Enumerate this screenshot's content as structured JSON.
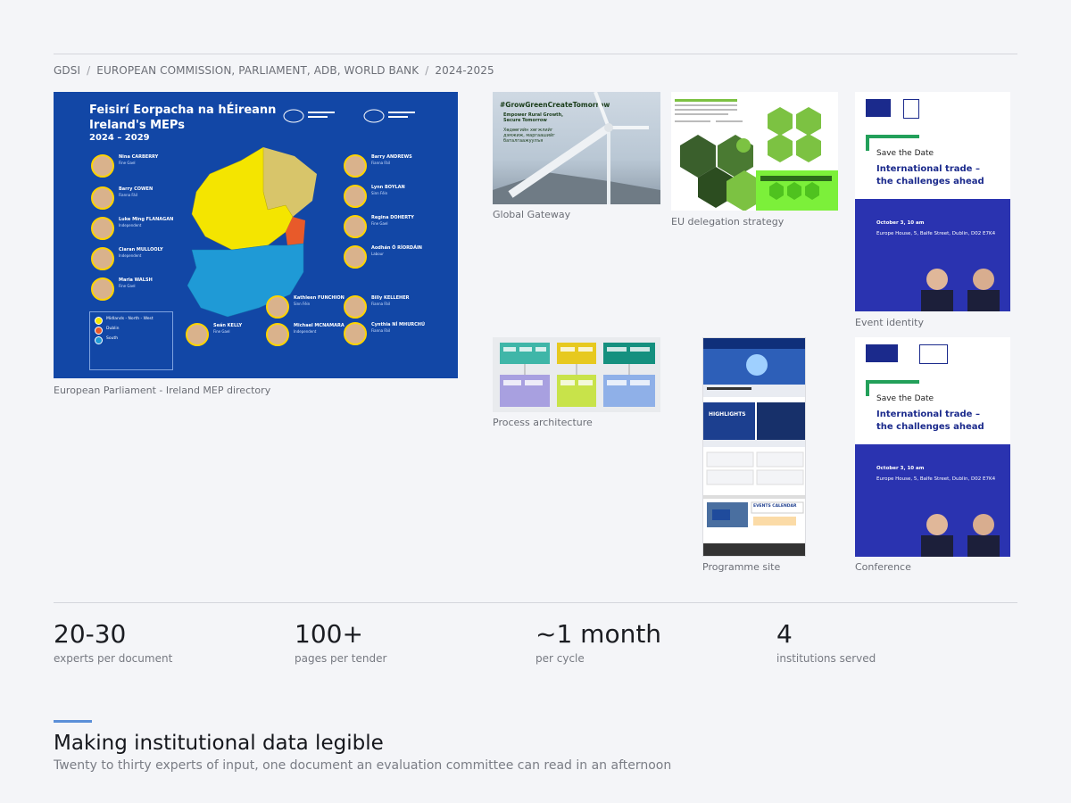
{
  "breadcrumb": [
    "GDSI",
    "EUROPEAN COMMISSION, PARLIAMENT, ADB, WORLD BANK",
    "2024-2025"
  ],
  "gallery": {
    "mep": {
      "caption": "European Parliament  -  Ireland MEP directory",
      "title_line1": "Feisirí Eorpacha na hÉireann",
      "title_line2": "Ireland's MEPs",
      "years": "2024 – 2029",
      "left_members": [
        {
          "name": "Nina CARBERRY",
          "party": "Fine Gael"
        },
        {
          "name": "Barry COWEN",
          "party": "Fianna Fáil"
        },
        {
          "name": "Luke Ming FLANAGAN",
          "party": "Independent"
        },
        {
          "name": "Ciaran MULLOOLY",
          "party": "Independent"
        },
        {
          "name": "Maria WALSH",
          "party": "Fine Gael"
        }
      ],
      "right_members": [
        {
          "name": "Barry ANDREWS",
          "party": "Fianna Fáil"
        },
        {
          "name": "Lynn BOYLAN",
          "party": "Sinn Féin"
        },
        {
          "name": "Regina DOHERTY",
          "party": "Fine Gael"
        },
        {
          "name": "Aodhán Ó RÍORDÁIN",
          "party": "Labour"
        },
        {
          "name": "Billy KELLEHER",
          "party": "Fianna Fáil"
        },
        {
          "name": "Cynthia NÍ MHURCHÚ",
          "party": "Fianna Fáil"
        }
      ],
      "centre_members": [
        {
          "name": "Kathleen FUNCHION",
          "party": "Sinn Féin"
        },
        {
          "name": "Michael MCNAMARA",
          "party": "Independent"
        },
        {
          "name": "Seán KELLY",
          "party": "Fine Gael"
        }
      ],
      "legend": [
        {
          "label": "Midlands - North - West",
          "color": "#f4e500"
        },
        {
          "label": "Dublin",
          "color": "#e85a2a"
        },
        {
          "label": "South",
          "color": "#1f9ad6"
        }
      ]
    },
    "global_gateway": {
      "caption": "Global Gateway",
      "hashtag": "#GrowGreenCreateTomorrow",
      "slogan": "Empower Rural Growth, Secure Tomorrow",
      "cyrillic": "Хөдөөгийн хөгжлийг дэмжиж, маргаашийг баталгаажуулъя"
    },
    "eu_delegation": {
      "caption": "EU delegation strategy"
    },
    "event_identity": {
      "caption": "Event identity",
      "save": "Save the Date",
      "title_line1": "International trade –",
      "title_line2": "the challenges ahead",
      "date": "October 3, 10 am",
      "place": "Europe House, 5, Balfe Street, Dublin, D02 E7K4"
    },
    "process": {
      "caption": "Process architecture"
    },
    "programme": {
      "caption": "Programme site",
      "highlights": "HIGHLIGHTS",
      "events": "EVENTS CALENDAR"
    },
    "conference": {
      "caption": "Conference",
      "save": "Save the Date",
      "title_line1": "International trade –",
      "title_line2": "the challenges ahead",
      "date": "October 3, 10 am",
      "place": "Europe House, 5, Balfe Street, Dublin, D02 E7K4"
    }
  },
  "stats": [
    {
      "value": "20-30",
      "label": "experts per document"
    },
    {
      "value": "100+",
      "label": "pages per tender"
    },
    {
      "value": "~1 month",
      "label": "per cycle"
    },
    {
      "value": "4",
      "label": "institutions served"
    }
  ],
  "section": {
    "heading": "Making institutional data legible",
    "subheading": "Twenty to thirty experts of input, one document an evaluation committee can read in an afternoon"
  },
  "colors": {
    "background": "#f4f5f8",
    "accent": "#5b8fd8",
    "mep_blue": "#1247a6"
  }
}
